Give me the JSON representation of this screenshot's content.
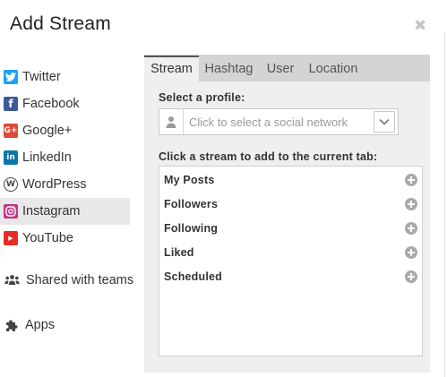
{
  "dialog": {
    "title": "Add Stream",
    "close_glyph": "✖"
  },
  "networks": [
    {
      "label": "Twitter",
      "icon": "twitter-icon",
      "color": "#1da1f2",
      "glyph": "t",
      "active": false
    },
    {
      "label": "Facebook",
      "icon": "facebook-icon",
      "color": "#3b5998",
      "glyph": "f",
      "active": false
    },
    {
      "label": "Google+",
      "icon": "google-plus-icon",
      "color": "#dd4b39",
      "glyph": "G+",
      "active": false
    },
    {
      "label": "LinkedIn",
      "icon": "linkedin-icon",
      "color": "#0e76a8",
      "glyph": "in",
      "active": false
    },
    {
      "label": "WordPress",
      "icon": "wordpress-icon",
      "color": "#464646",
      "glyph": "W",
      "active": false
    },
    {
      "label": "Instagram",
      "icon": "instagram-icon",
      "color": "#c13584",
      "glyph": "",
      "active": true
    },
    {
      "label": "YouTube",
      "icon": "youtube-icon",
      "color": "#e52d27",
      "glyph": "▶",
      "active": false
    }
  ],
  "extras": {
    "shared": {
      "label": "Shared with teams",
      "icon": "team-icon"
    },
    "apps": {
      "label": "Apps",
      "icon": "puzzle-icon"
    }
  },
  "tabs": [
    {
      "label": "Stream",
      "active": true
    },
    {
      "label": "Hashtag",
      "active": false
    },
    {
      "label": "User",
      "active": false
    },
    {
      "label": "Location",
      "active": false
    }
  ],
  "profile": {
    "label": "Select a profile:",
    "placeholder": "Click to select a social network"
  },
  "streams": {
    "label": "Click a stream to add to the current tab:",
    "items": [
      "My Posts",
      "Followers",
      "Following",
      "Liked",
      "Scheduled"
    ]
  },
  "colors": {
    "panel_bg": "#efefef",
    "tabbar_bg": "#d4d4d4",
    "active_item_bg": "#e8e8e8",
    "add_icon": "#a9a9a9"
  }
}
